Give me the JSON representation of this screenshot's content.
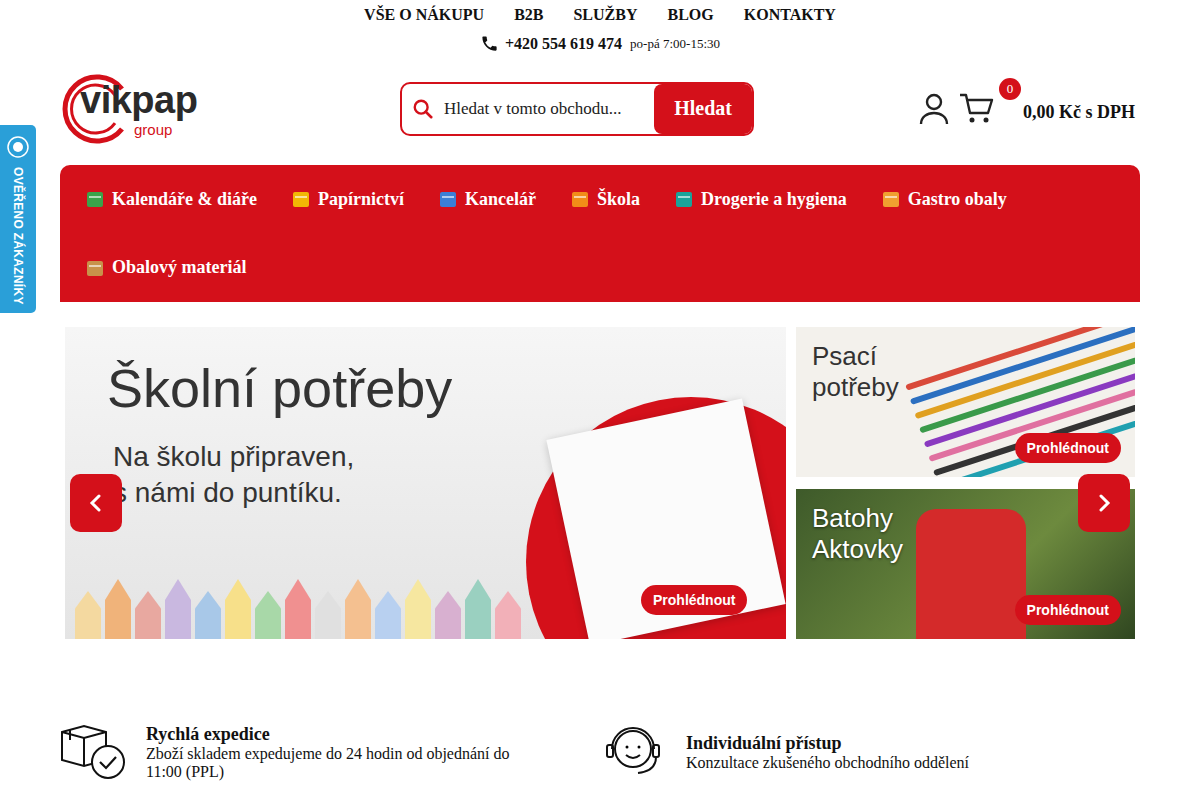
{
  "top_nav": {
    "links": [
      "VŠE O NÁKUPU",
      "B2B",
      "SLUŽBY",
      "BLOG",
      "KONTAKTY"
    ],
    "phone": "+420 554 619 474",
    "hours": "po-pá 7:00-15:30"
  },
  "logo": {
    "name": "vikpap",
    "sub": "group"
  },
  "search": {
    "placeholder": "Hledat v tomto obchodu...",
    "button": "Hledat"
  },
  "cart": {
    "count": "0",
    "total": "0,00 Kč s DPH"
  },
  "categories": [
    {
      "label": "Kalendáře & diáře"
    },
    {
      "label": "Papírnictví"
    },
    {
      "label": "Kancelář"
    },
    {
      "label": "Škola"
    },
    {
      "label": "Drogerie a hygiena"
    },
    {
      "label": "Gastro obaly"
    },
    {
      "label": "Obalový materiál"
    }
  ],
  "verified_badge": "OVĚŘENO ZÁKAZNÍKY",
  "banners": {
    "main": {
      "title": "Školní potřeby",
      "subtitle_lines": [
        "Na školu připraven,",
        "s námi do puntíku."
      ],
      "button": "Prohlédnout"
    },
    "side": [
      {
        "title_lines": [
          "Psací",
          "potřeby"
        ],
        "button": "Prohlédnout"
      },
      {
        "title_lines": [
          "Batohy",
          "Aktovky"
        ],
        "button": "Prohlédnout"
      }
    ]
  },
  "features": [
    {
      "title": "Rychlá expedice",
      "text": "Zboží skladem expedujeme do 24 hodin od objednání do 11:00 (PPL)"
    },
    {
      "title": "Individuální přístup",
      "text": "Konzultace zkušeného obchodního oddělení"
    }
  ]
}
